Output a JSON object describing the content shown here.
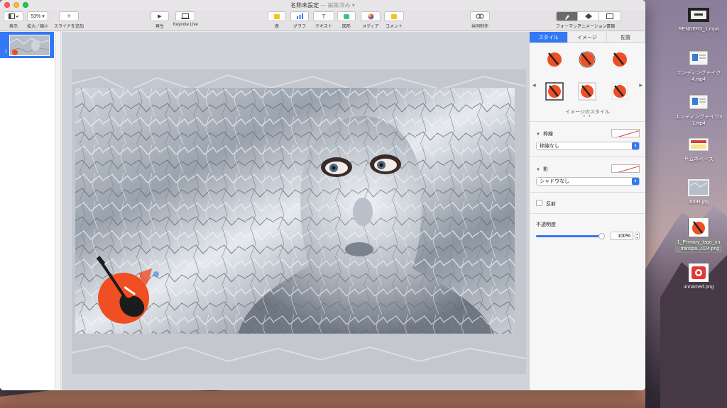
{
  "window": {
    "title": "名称未設定",
    "edited": "— 編集済み ▾"
  },
  "toolbar": {
    "view_label": "表示",
    "zoom_value": "53% ▾",
    "zoom_label": "拡大／縮小",
    "add_slide_label": "スライドを追加",
    "play_label": "再生",
    "keynote_live_label": "Keynote Live",
    "table_label": "表",
    "chart_label": "グラフ",
    "text_label": "テキスト",
    "shape_label": "図形",
    "media_label": "メディア",
    "comment_label": "コメント",
    "collaborate_label": "共同制作",
    "format_label": "フォーマット",
    "animate_label": "アニメーション",
    "document_label": "書類"
  },
  "navigator": {
    "slide_number": "1"
  },
  "inspector": {
    "tabs": [
      "スタイル",
      "イメージ",
      "配置"
    ],
    "styles_caption": "イメージのスタイル",
    "dots": "• •",
    "border": {
      "label": "枠線",
      "value": "枠線なし"
    },
    "shadow": {
      "label": "影",
      "value": "シャドウなし"
    },
    "reflection": {
      "label": "反射"
    },
    "opacity": {
      "label": "不透明度",
      "value": "100%",
      "level": 1.0
    }
  },
  "desktop": {
    "icons": [
      {
        "label": "RENDER3_1.mp4"
      },
      {
        "label": "エンディングテイク\n4.mp4"
      },
      {
        "label": "エンディングテイク3\n1.mp4"
      },
      {
        "label": "サムネベース"
      },
      {
        "label": "300H.jpg"
      },
      {
        "label": "1_Primary_logo_on\n_transpa...024.png"
      },
      {
        "label": "unnamed.png"
      }
    ]
  },
  "colors": {
    "accent": "#3478f6",
    "logo_orange": "#f04e23"
  }
}
